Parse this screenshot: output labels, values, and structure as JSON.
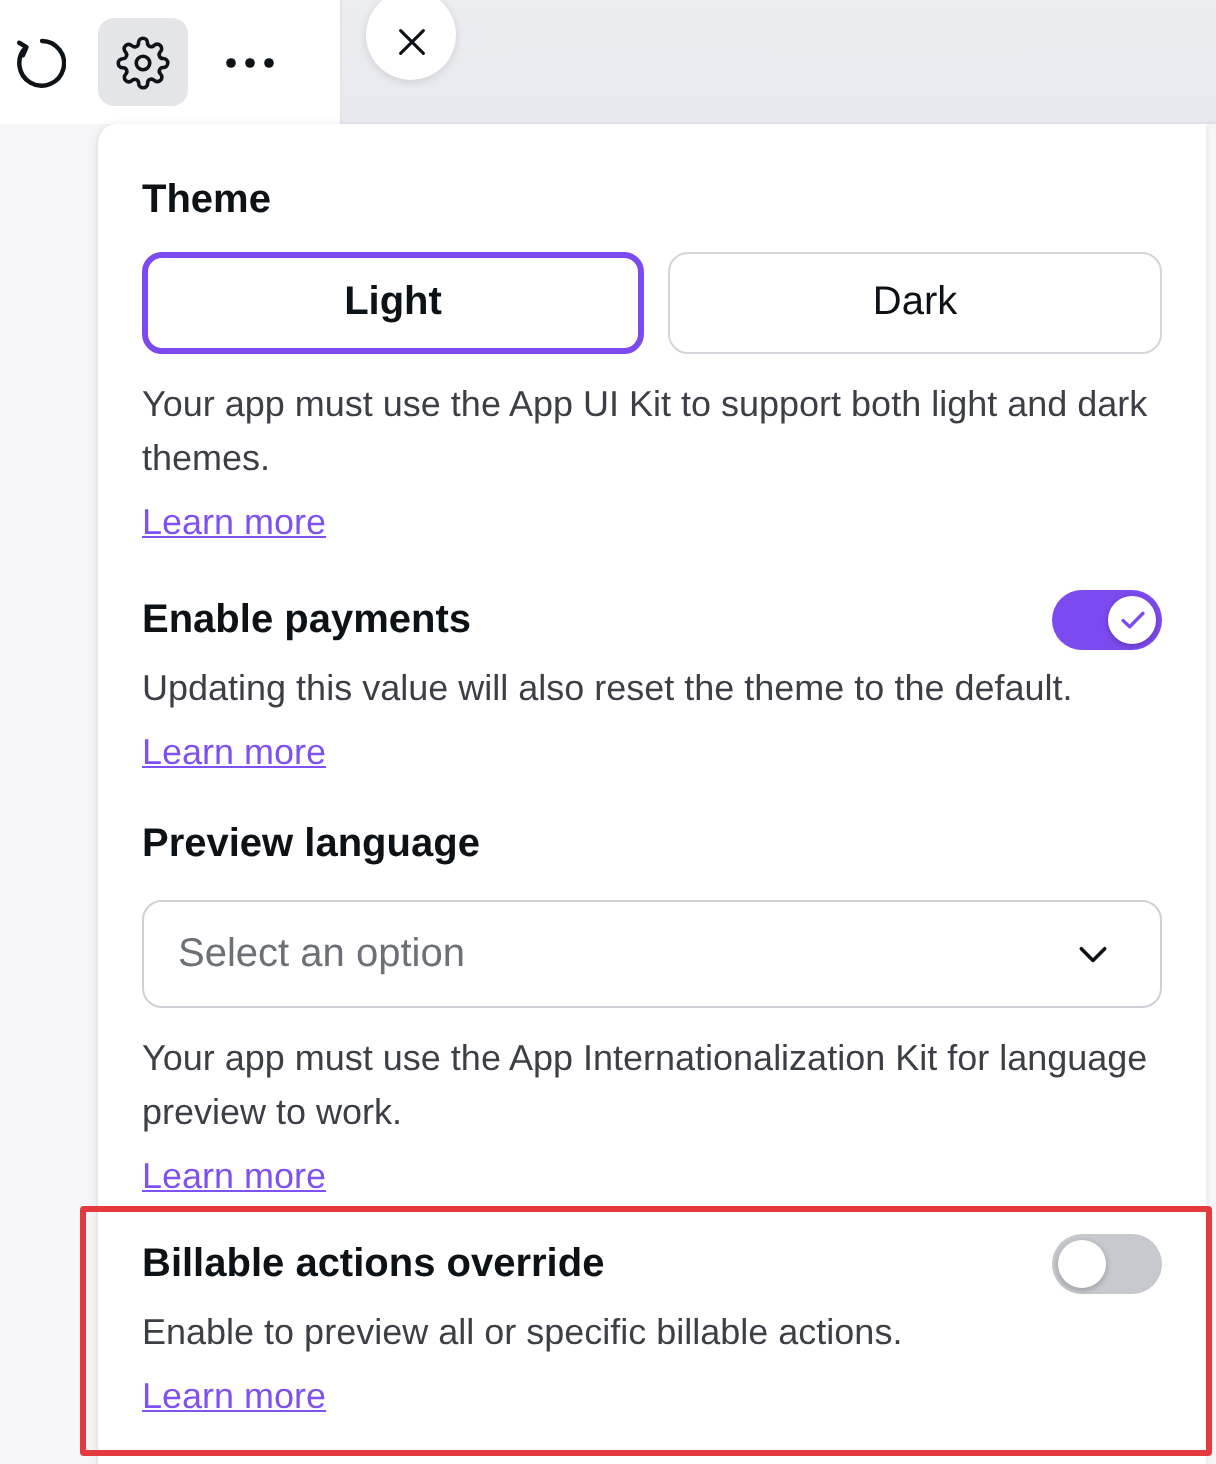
{
  "toolbar": {
    "items": [
      {
        "kind": "refresh",
        "selected": false
      },
      {
        "kind": "settings",
        "selected": true
      },
      {
        "kind": "more",
        "selected": false
      }
    ]
  },
  "panel": {
    "sections": [
      {
        "kind": "segmented",
        "heading": "Theme",
        "options": [
          {
            "label": "Light",
            "selected": true
          },
          {
            "label": "Dark",
            "selected": false
          }
        ],
        "description": "Your app must use the App UI Kit to support both light and dark themes.",
        "link": "Learn more",
        "highlighted": false
      },
      {
        "kind": "toggle",
        "heading": "Enable payments",
        "on": true,
        "description": "Updating this value will also reset the theme to the default.",
        "link": "Learn more",
        "highlighted": false
      },
      {
        "kind": "select",
        "heading": "Preview language",
        "placeholder": "Select an option",
        "description": "Your app must use the App Internationalization Kit for language preview to work.",
        "link": "Learn more",
        "highlighted": false
      },
      {
        "kind": "toggle",
        "heading": "Billable actions override",
        "on": false,
        "description": "Enable to preview all or specific billable actions.",
        "link": "Learn more",
        "highlighted": true
      }
    ]
  }
}
